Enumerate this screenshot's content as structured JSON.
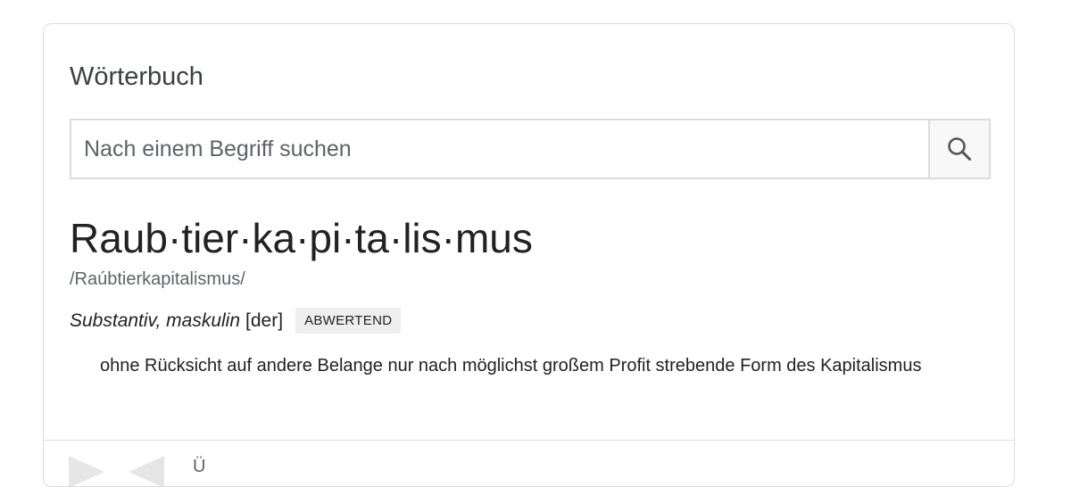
{
  "widget": {
    "title": "Wörterbuch"
  },
  "search": {
    "placeholder": "Nach einem Begriff suchen",
    "value": "",
    "button_icon": "search-icon"
  },
  "entry": {
    "headword": "Raub·tier·ka·pi·ta·lis·mus",
    "pronunciation": "/Raúbtierkapitalismus/",
    "part_of_speech": "Substantiv, maskulin",
    "article": "[der]",
    "usage_label": "ABWERTEND",
    "definition": "ohne Rücksicht auf andere Belange nur nach möglichst großem Profit strebende Form des Kapitalismus"
  },
  "footer": {
    "partial_text": "Ü",
    "icons": [
      "play-icon",
      "back-icon"
    ]
  },
  "colors": {
    "border": "#dadce0",
    "text": "#222222",
    "muted": "#5f6368",
    "badge_bg": "#eeeeee"
  }
}
